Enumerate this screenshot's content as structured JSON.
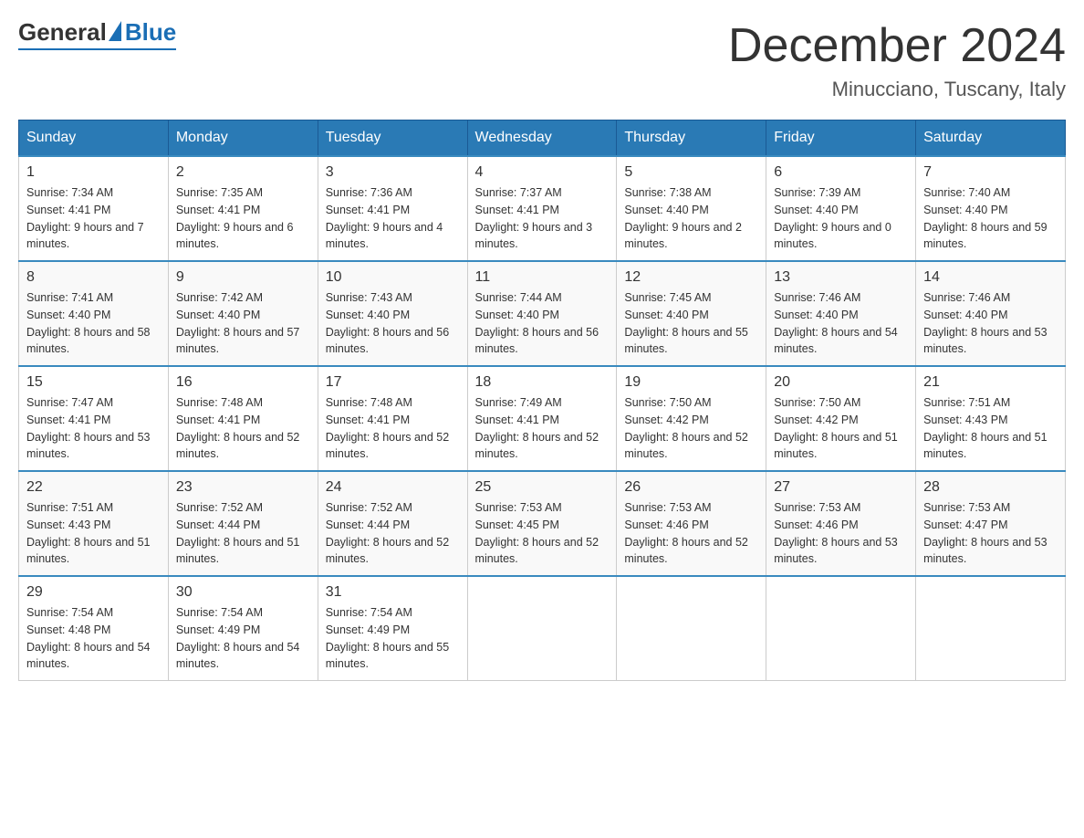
{
  "header": {
    "logo": {
      "text_general": "General",
      "text_blue": "Blue"
    },
    "title": "December 2024",
    "location": "Minucciano, Tuscany, Italy"
  },
  "calendar": {
    "days_of_week": [
      "Sunday",
      "Monday",
      "Tuesday",
      "Wednesday",
      "Thursday",
      "Friday",
      "Saturday"
    ],
    "weeks": [
      [
        {
          "day": "1",
          "sunrise": "7:34 AM",
          "sunset": "4:41 PM",
          "daylight": "9 hours and 7 minutes."
        },
        {
          "day": "2",
          "sunrise": "7:35 AM",
          "sunset": "4:41 PM",
          "daylight": "9 hours and 6 minutes."
        },
        {
          "day": "3",
          "sunrise": "7:36 AM",
          "sunset": "4:41 PM",
          "daylight": "9 hours and 4 minutes."
        },
        {
          "day": "4",
          "sunrise": "7:37 AM",
          "sunset": "4:41 PM",
          "daylight": "9 hours and 3 minutes."
        },
        {
          "day": "5",
          "sunrise": "7:38 AM",
          "sunset": "4:40 PM",
          "daylight": "9 hours and 2 minutes."
        },
        {
          "day": "6",
          "sunrise": "7:39 AM",
          "sunset": "4:40 PM",
          "daylight": "9 hours and 0 minutes."
        },
        {
          "day": "7",
          "sunrise": "7:40 AM",
          "sunset": "4:40 PM",
          "daylight": "8 hours and 59 minutes."
        }
      ],
      [
        {
          "day": "8",
          "sunrise": "7:41 AM",
          "sunset": "4:40 PM",
          "daylight": "8 hours and 58 minutes."
        },
        {
          "day": "9",
          "sunrise": "7:42 AM",
          "sunset": "4:40 PM",
          "daylight": "8 hours and 57 minutes."
        },
        {
          "day": "10",
          "sunrise": "7:43 AM",
          "sunset": "4:40 PM",
          "daylight": "8 hours and 56 minutes."
        },
        {
          "day": "11",
          "sunrise": "7:44 AM",
          "sunset": "4:40 PM",
          "daylight": "8 hours and 56 minutes."
        },
        {
          "day": "12",
          "sunrise": "7:45 AM",
          "sunset": "4:40 PM",
          "daylight": "8 hours and 55 minutes."
        },
        {
          "day": "13",
          "sunrise": "7:46 AM",
          "sunset": "4:40 PM",
          "daylight": "8 hours and 54 minutes."
        },
        {
          "day": "14",
          "sunrise": "7:46 AM",
          "sunset": "4:40 PM",
          "daylight": "8 hours and 53 minutes."
        }
      ],
      [
        {
          "day": "15",
          "sunrise": "7:47 AM",
          "sunset": "4:41 PM",
          "daylight": "8 hours and 53 minutes."
        },
        {
          "day": "16",
          "sunrise": "7:48 AM",
          "sunset": "4:41 PM",
          "daylight": "8 hours and 52 minutes."
        },
        {
          "day": "17",
          "sunrise": "7:48 AM",
          "sunset": "4:41 PM",
          "daylight": "8 hours and 52 minutes."
        },
        {
          "day": "18",
          "sunrise": "7:49 AM",
          "sunset": "4:41 PM",
          "daylight": "8 hours and 52 minutes."
        },
        {
          "day": "19",
          "sunrise": "7:50 AM",
          "sunset": "4:42 PM",
          "daylight": "8 hours and 52 minutes."
        },
        {
          "day": "20",
          "sunrise": "7:50 AM",
          "sunset": "4:42 PM",
          "daylight": "8 hours and 51 minutes."
        },
        {
          "day": "21",
          "sunrise": "7:51 AM",
          "sunset": "4:43 PM",
          "daylight": "8 hours and 51 minutes."
        }
      ],
      [
        {
          "day": "22",
          "sunrise": "7:51 AM",
          "sunset": "4:43 PM",
          "daylight": "8 hours and 51 minutes."
        },
        {
          "day": "23",
          "sunrise": "7:52 AM",
          "sunset": "4:44 PM",
          "daylight": "8 hours and 51 minutes."
        },
        {
          "day": "24",
          "sunrise": "7:52 AM",
          "sunset": "4:44 PM",
          "daylight": "8 hours and 52 minutes."
        },
        {
          "day": "25",
          "sunrise": "7:53 AM",
          "sunset": "4:45 PM",
          "daylight": "8 hours and 52 minutes."
        },
        {
          "day": "26",
          "sunrise": "7:53 AM",
          "sunset": "4:46 PM",
          "daylight": "8 hours and 52 minutes."
        },
        {
          "day": "27",
          "sunrise": "7:53 AM",
          "sunset": "4:46 PM",
          "daylight": "8 hours and 53 minutes."
        },
        {
          "day": "28",
          "sunrise": "7:53 AM",
          "sunset": "4:47 PM",
          "daylight": "8 hours and 53 minutes."
        }
      ],
      [
        {
          "day": "29",
          "sunrise": "7:54 AM",
          "sunset": "4:48 PM",
          "daylight": "8 hours and 54 minutes."
        },
        {
          "day": "30",
          "sunrise": "7:54 AM",
          "sunset": "4:49 PM",
          "daylight": "8 hours and 54 minutes."
        },
        {
          "day": "31",
          "sunrise": "7:54 AM",
          "sunset": "4:49 PM",
          "daylight": "8 hours and 55 minutes."
        },
        null,
        null,
        null,
        null
      ]
    ]
  }
}
